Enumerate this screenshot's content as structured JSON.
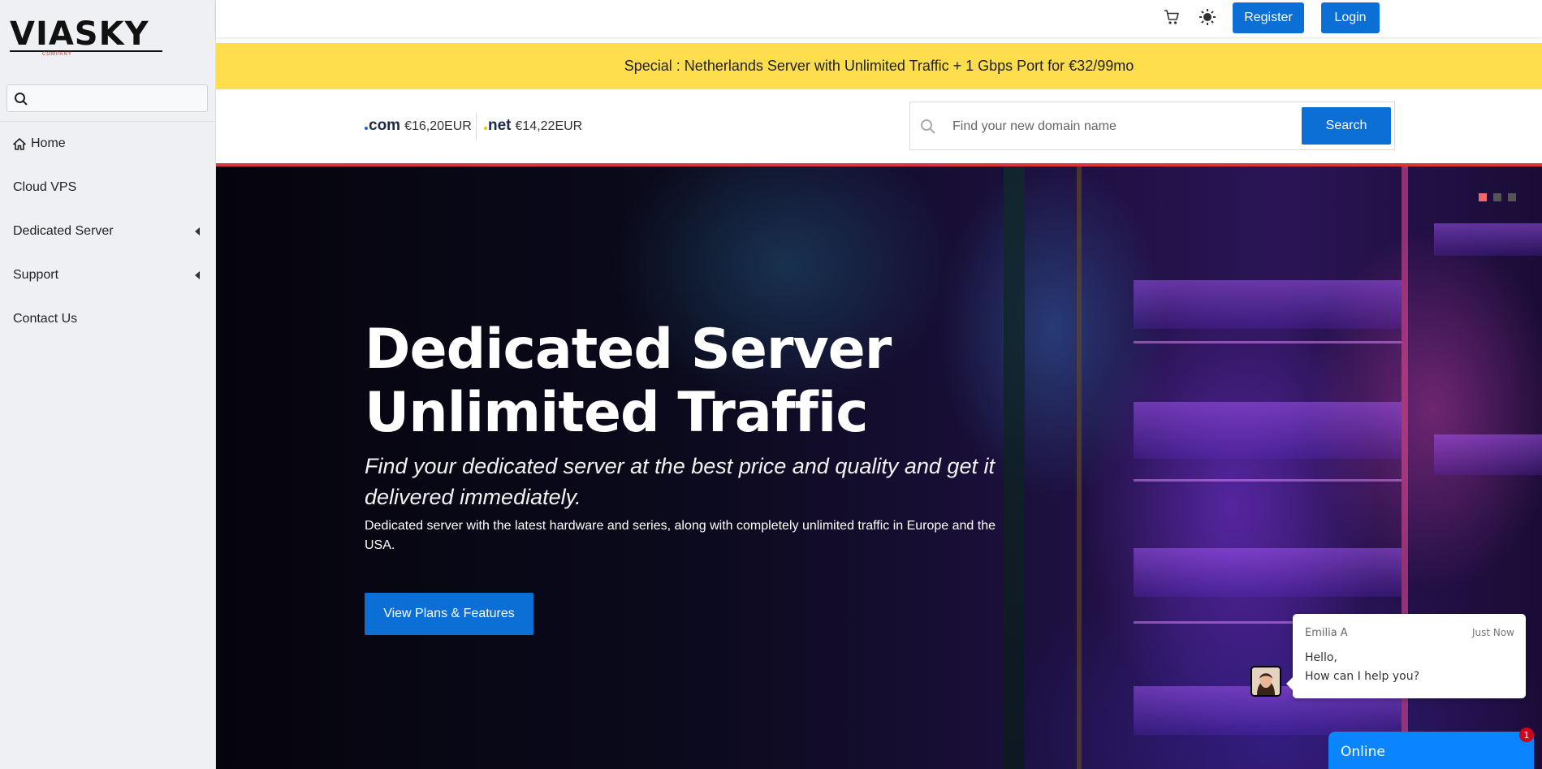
{
  "brand": {
    "logo_text": "VIASKY",
    "logo_subtext": "COMPANY"
  },
  "sidebar": {
    "search_placeholder": "",
    "items": [
      {
        "label": "Home",
        "icon": "home-icon",
        "has_submenu": false
      },
      {
        "label": "Cloud VPS",
        "has_submenu": false
      },
      {
        "label": "Dedicated Server",
        "has_submenu": true
      },
      {
        "label": "Support",
        "has_submenu": true
      },
      {
        "label": "Contact Us",
        "has_submenu": false
      }
    ]
  },
  "header": {
    "cart_icon": "cart-icon",
    "theme_icon": "theme-toggle-icon",
    "register_label": "Register",
    "login_label": "Login"
  },
  "promo": {
    "text": "Special : Netherlands Server with Unlimited Traffic + 1 Gbps Port for €32/99mo"
  },
  "domains": {
    "tlds": [
      {
        "name": "com",
        "price": "€16,20EUR",
        "dot_color": "#0b6fd6"
      },
      {
        "name": "net",
        "price": "€14,22EUR",
        "dot_color": "#f2c200"
      }
    ],
    "search_placeholder": "Find your new domain name",
    "search_button": "Search"
  },
  "hero": {
    "title_line1": "Dedicated Server",
    "title_line2": "Unlimited Traffic",
    "subtitle": "Find your dedicated server at the best price and quality and get it delivered immediately.",
    "description": "Dedicated server with the latest hardware and series, along with completely unlimited traffic in Europe and the USA.",
    "cta_label": "View Plans & Features",
    "slides": 3,
    "active_slide": 1
  },
  "chat": {
    "agent_name": "Emilia A",
    "time": "Just Now",
    "message_line1": "Hello,",
    "message_line2": "How can I help you?",
    "status_label": "Online",
    "unread_count": "1"
  },
  "colors": {
    "primary": "#0b6fd6",
    "promo": "#fede4d",
    "accent_line": "#d9363e",
    "chat": "#0a84ff"
  }
}
